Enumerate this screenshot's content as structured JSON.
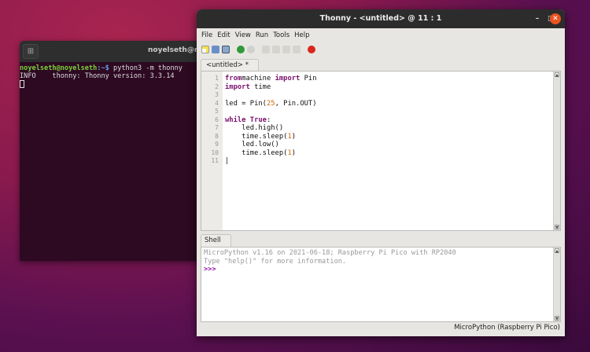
{
  "terminal": {
    "title": "noyelseth@no",
    "prompt_user": "noyelseth@noyelseth",
    "prompt_path": ":~$",
    "command": " python3 -m thonny",
    "output": "INFO    thonny: Thonny version: 3.3.14"
  },
  "window": {
    "title": "Thonny - <untitled> @ 11 : 1"
  },
  "menu": [
    "File",
    "Edit",
    "View",
    "Run",
    "Tools",
    "Help"
  ],
  "toolbar": [
    "new",
    "open",
    "save",
    "run",
    "debug",
    "step-over",
    "step-into",
    "step-out",
    "resume",
    "stop"
  ],
  "editor": {
    "tab": "<untitled> *",
    "line_numbers": [
      "1",
      "2",
      "3",
      "4",
      "5",
      "6",
      "7",
      "8",
      "9",
      "10",
      "11"
    ],
    "lines": [
      [
        [
          "kw",
          "from"
        ],
        [
          "",
          "machine "
        ],
        [
          "kw",
          "import"
        ],
        [
          "",
          " Pin"
        ]
      ],
      [
        [
          "kw",
          "import"
        ],
        [
          "",
          " time"
        ]
      ],
      [],
      [
        [
          "",
          "led = Pin("
        ],
        [
          "num",
          "25"
        ],
        [
          "",
          ", Pin.OUT)"
        ]
      ],
      [],
      [
        [
          "kw",
          "while"
        ],
        [
          "",
          " "
        ],
        [
          "kw",
          "True"
        ],
        [
          "",
          ":"
        ]
      ],
      [
        [
          "",
          "    led.high()"
        ]
      ],
      [
        [
          "",
          "    time.sleep("
        ],
        [
          "num",
          "1"
        ],
        [
          "",
          ")"
        ]
      ],
      [
        [
          "",
          "    led.low()"
        ]
      ],
      [
        [
          "",
          "    time.sleep("
        ],
        [
          "num",
          "1"
        ],
        [
          "",
          ")"
        ]
      ],
      [
        [
          "",
          "|"
        ]
      ]
    ]
  },
  "shell": {
    "tab": "Shell",
    "lines": [
      "MicroPython v1.16 on 2021-06-18; Raspberry Pi Pico with RP2040",
      "Type \"help()\" for more information."
    ],
    "prompt": ">>>"
  },
  "status": "MicroPython (Raspberry Pi Pico)"
}
